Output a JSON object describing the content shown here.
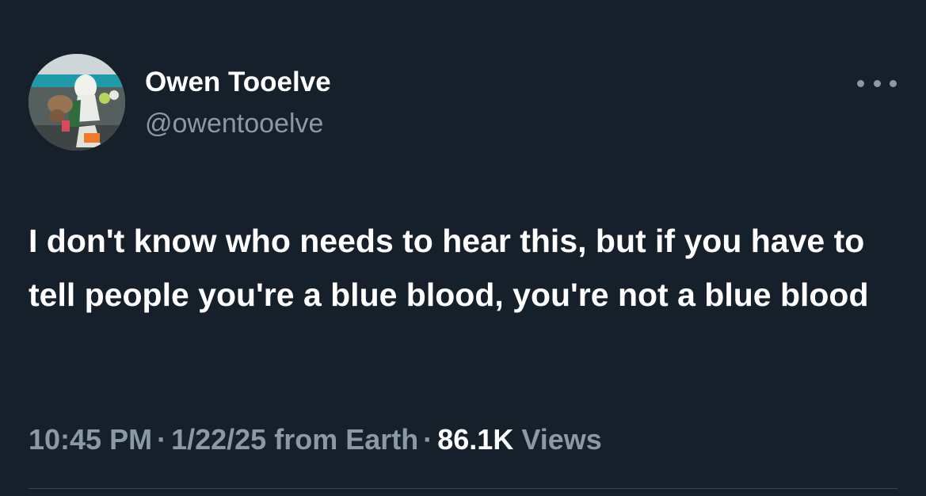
{
  "author": {
    "display_name": "Owen Tooelve",
    "handle": "@owentooelve"
  },
  "more_button": {
    "icon": "more-horizontal-icon"
  },
  "tweet": {
    "text": "I don't know who needs to hear this, but if you have to tell people you're a blue blood, you're not a blue blood",
    "time": "10:45 PM",
    "date": "1/22/25",
    "source": "from Earth",
    "views_count": "86.1K",
    "views_label": "Views"
  },
  "colors": {
    "background": "#15202b",
    "primary_text": "#ffffff",
    "secondary_text": "#8b98a5",
    "divider": "#38444d"
  }
}
